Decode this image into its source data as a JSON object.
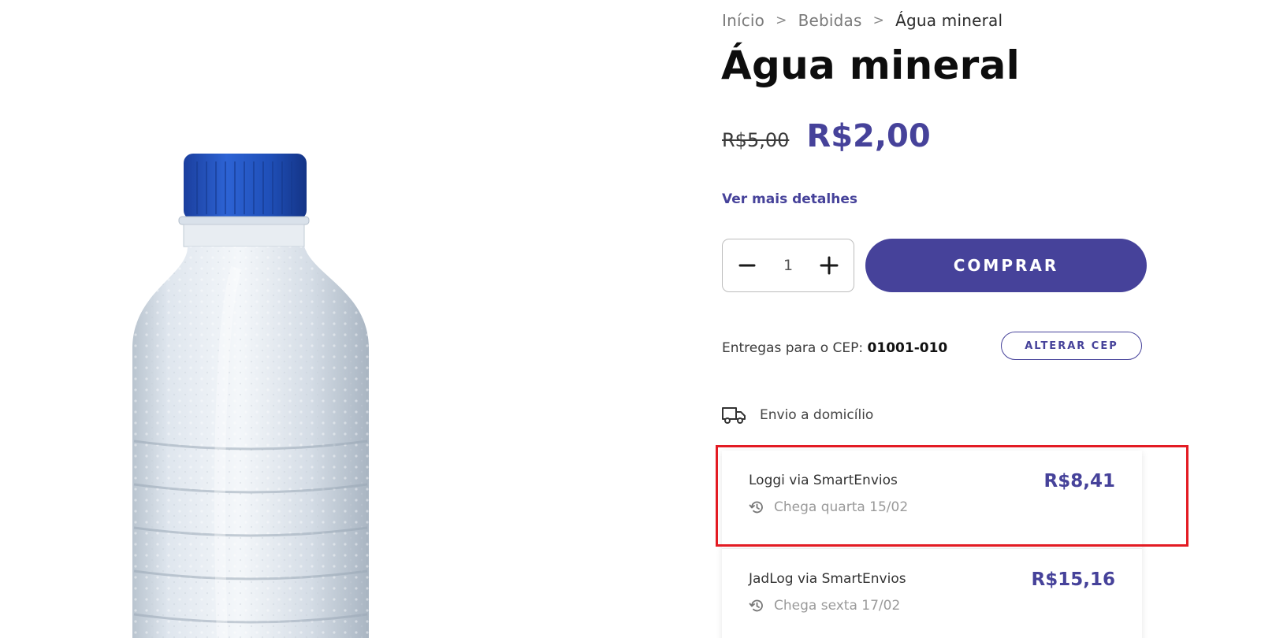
{
  "breadcrumb": {
    "items": [
      "Início",
      "Bebidas",
      "Água mineral"
    ],
    "separator": ">"
  },
  "product": {
    "title": "Água mineral",
    "old_price": "R$5,00",
    "price": "R$2,00",
    "details_link": "Ver mais detalhes",
    "image_icon": "water-bottle-image"
  },
  "purchase": {
    "quantity": "1",
    "buy_label": "COMPRAR"
  },
  "delivery": {
    "cep_prefix": "Entregas para o CEP:",
    "cep_value": "01001-010",
    "change_cep_label": "ALTERAR CEP",
    "section_label": "Envio a domicílio",
    "section_icon": "truck-icon",
    "options": [
      {
        "name": "Loggi via SmartEnvios",
        "eta": "Chega quarta 15/02",
        "price": "R$8,41",
        "highlighted": true
      },
      {
        "name": "JadLog via SmartEnvios",
        "eta": "Chega sexta 17/02",
        "price": "R$15,16",
        "highlighted": false
      }
    ]
  },
  "colors": {
    "accent": "#46429a",
    "highlight": "#e31b23"
  }
}
